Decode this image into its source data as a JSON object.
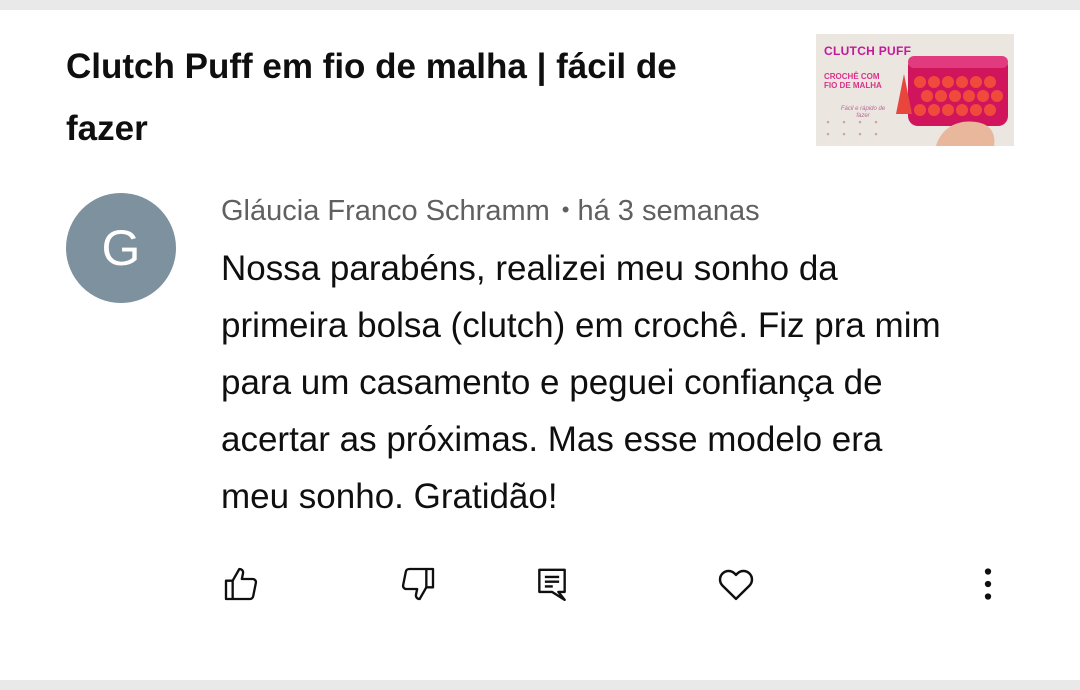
{
  "video": {
    "title": "Clutch Puff em fio de malha | fácil de fazer",
    "thumbnail": {
      "title": "CLUTCH PUFF",
      "subtitle": "CROCHÊ COM FIO DE MALHA",
      "tagline": "Fácil e rápido de fazer",
      "accent_color": "#c2189a"
    }
  },
  "comment": {
    "avatar_letter": "G",
    "avatar_color": "#7d919e",
    "author": "Gláucia Franco Schramm",
    "separator": "•",
    "time": "há 3 semanas",
    "text": "Nossa parabéns, realizei meu sonho da primeira bolsa (clutch) em crochê. Fiz pra mim para um casamento e peguei confiança de acertar as próximas. Mas esse modelo era meu sonho. Gratidão!"
  },
  "actions": [
    {
      "icon": "thumbs-up-icon"
    },
    {
      "icon": "thumbs-down-icon"
    },
    {
      "icon": "reply-icon"
    },
    {
      "icon": "heart-icon"
    },
    {
      "icon": "more-vertical-icon"
    }
  ]
}
